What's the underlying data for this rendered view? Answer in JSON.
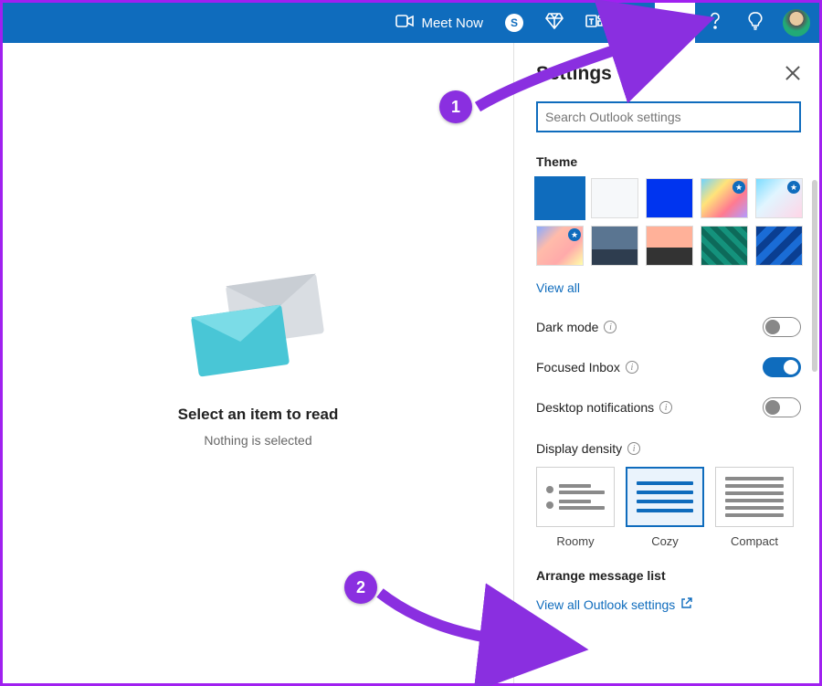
{
  "topbar": {
    "meet_now": "Meet Now",
    "skype_letter": "S"
  },
  "reading_pane": {
    "title": "Select an item to read",
    "subtitle": "Nothing is selected"
  },
  "settings": {
    "heading": "Settings",
    "search_placeholder": "Search Outlook settings",
    "theme_label": "Theme",
    "view_all": "View all",
    "dark_mode_label": "Dark mode",
    "focused_inbox_label": "Focused Inbox",
    "desktop_notif_label": "Desktop notifications",
    "display_density_label": "Display density",
    "density_roomy": "Roomy",
    "density_cozy": "Cozy",
    "density_compact": "Compact",
    "arrange_label": "Arrange message list",
    "view_all_outlook": "View all Outlook settings"
  },
  "annotations": {
    "step1": "1",
    "step2": "2"
  }
}
